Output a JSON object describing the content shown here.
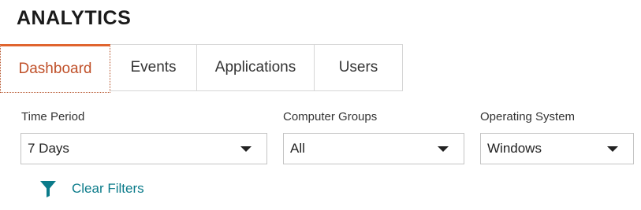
{
  "header": {
    "title": "ANALYTICS"
  },
  "tabs": [
    {
      "label": "Dashboard",
      "active": true
    },
    {
      "label": "Events",
      "active": false
    },
    {
      "label": "Applications",
      "active": false
    },
    {
      "label": "Users",
      "active": false
    }
  ],
  "filters": {
    "time_period": {
      "label": "Time Period",
      "value": "7 Days"
    },
    "computer_groups": {
      "label": "Computer Groups",
      "value": "All"
    },
    "operating_system": {
      "label": "Operating System",
      "value": "Windows"
    }
  },
  "clear_filters": {
    "label": "Clear Filters",
    "icon": "funnel-icon"
  },
  "colors": {
    "accent": "#e0642e",
    "active_tab_text": "#c0512a",
    "link": "#0b7b8a"
  }
}
